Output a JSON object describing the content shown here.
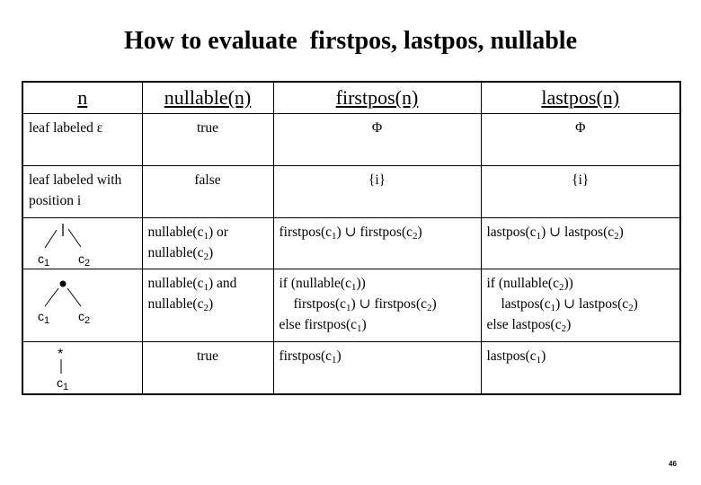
{
  "title": "How to evaluate  firstpos, lastpos, nullable",
  "table": {
    "headers": [
      "n",
      "nullable(n)",
      "firstpos(n)",
      "lastpos(n)"
    ],
    "rows": [
      {
        "n": "leaf labeled ε",
        "nullable": "true",
        "firstpos": "Φ",
        "lastpos": "Φ"
      },
      {
        "n": "leaf labeled with position i",
        "nullable": "false",
        "firstpos": "{i}",
        "lastpos": "{i}"
      }
    ],
    "or_row": {
      "node_symbol": "|",
      "child1": "c",
      "child1_sub": "1",
      "child2": "c",
      "child2_sub": "2",
      "nullable": [
        "nullable(c",
        "1",
        ") or",
        "nullable(c",
        "2",
        ")"
      ],
      "firstpos": [
        "firstpos(c",
        "1",
        ") ∪ firstpos(c",
        "2",
        ")"
      ],
      "lastpos": [
        "lastpos(c",
        "1",
        ") ∪ lastpos(c",
        "2",
        ")"
      ]
    },
    "cat_row": {
      "node_symbol": "•",
      "child1": "c",
      "child1_sub": "1",
      "child2": "c",
      "child2_sub": "2",
      "nullable": [
        "nullable(c",
        "1",
        ") and",
        "nullable(c",
        "2",
        ")"
      ],
      "firstpos": {
        "line1": [
          "if (nullable(c",
          "1",
          "))"
        ],
        "line2": [
          "firstpos(c",
          "1",
          ") ∪ firstpos(c",
          "2",
          ")"
        ],
        "line3": [
          "else firstpos(c",
          "1",
          ")"
        ]
      },
      "lastpos": {
        "line1": [
          "if (nullable(c",
          "2",
          "))"
        ],
        "line2": [
          "lastpos(c",
          "1",
          ") ∪ lastpos(c",
          "2",
          ")"
        ],
        "line3": [
          "else lastpos(c",
          "2",
          ")"
        ]
      }
    },
    "star_row": {
      "node_symbol": "*",
      "child1": "c",
      "child1_sub": "1",
      "nullable": "true",
      "firstpos": [
        "firstpos(c",
        "1",
        ")"
      ],
      "lastpos": [
        "lastpos(c",
        "1",
        ")"
      ]
    }
  },
  "page_number": "46"
}
